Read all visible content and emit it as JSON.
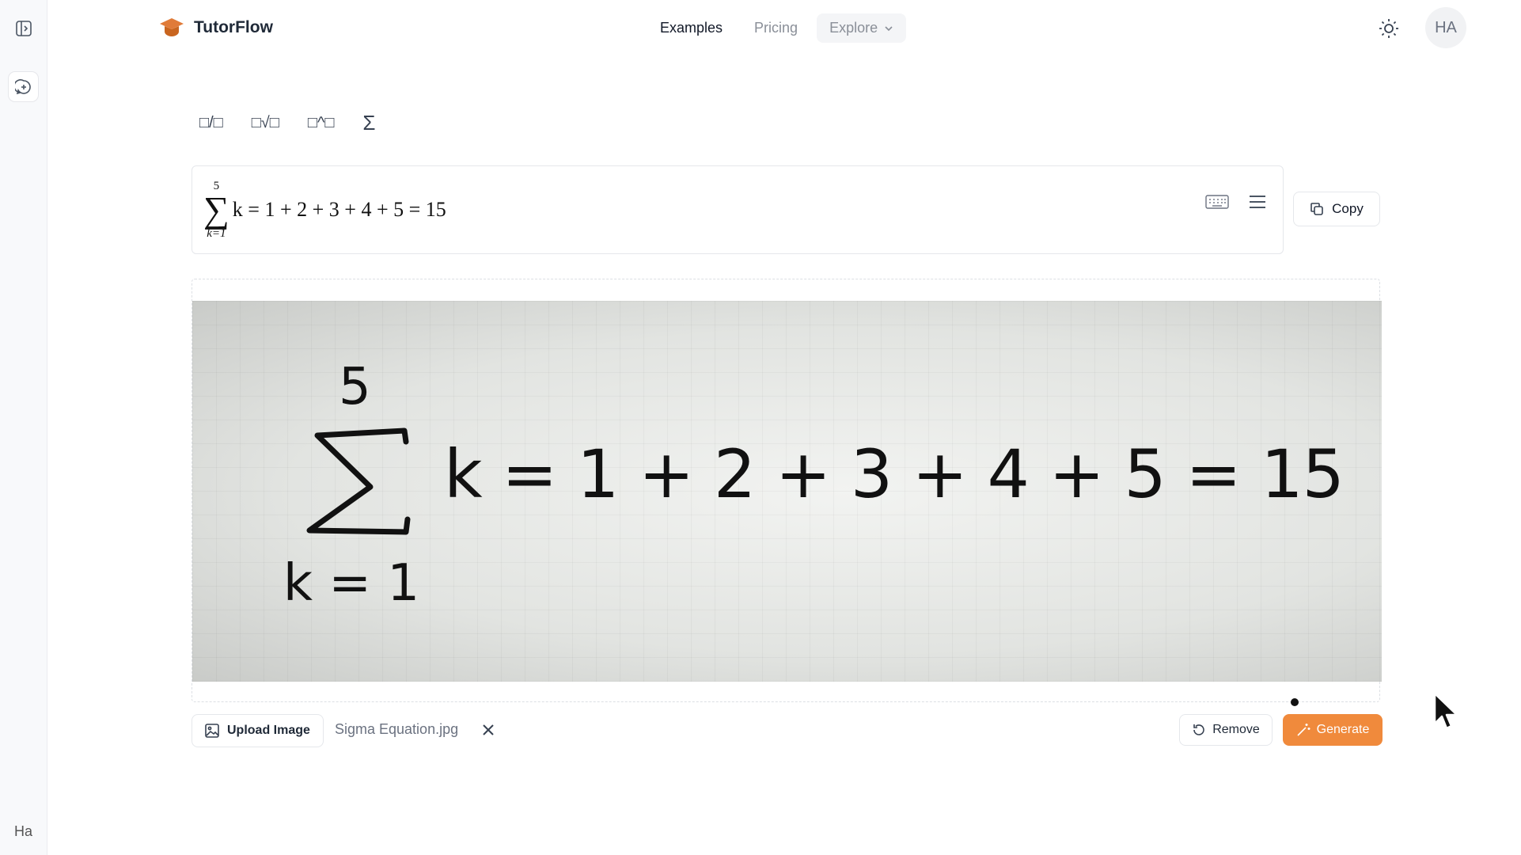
{
  "sidebar": {
    "user_initials": "Ha"
  },
  "header": {
    "brand": "TutorFlow",
    "nav": [
      "Examples",
      "Pricing",
      "Explore"
    ],
    "avatar_initials": "HA"
  },
  "toolbar": {
    "tools": [
      "□/□",
      "□√□",
      "□^□",
      "Σ"
    ]
  },
  "equation": {
    "upper_limit": "5",
    "lower_limit": "k=1",
    "sum_symbol": "∑",
    "body": "k = 1 + 2 + 3 + 4 + 5 = 15",
    "copy_label": "Copy"
  },
  "image": {
    "handwritten_top": "5",
    "handwritten_bottom": "k = 1",
    "handwritten_body": "k = 1 + 2 + 3 + 4 + 5 = 15"
  },
  "upload": {
    "button_label": "Upload Image",
    "file_name": "Sigma Equation.jpg",
    "remove_label": "Remove",
    "generate_label": "Generate"
  },
  "colors": {
    "accent": "#f08a3c",
    "brand_icon": "#e07b39"
  }
}
